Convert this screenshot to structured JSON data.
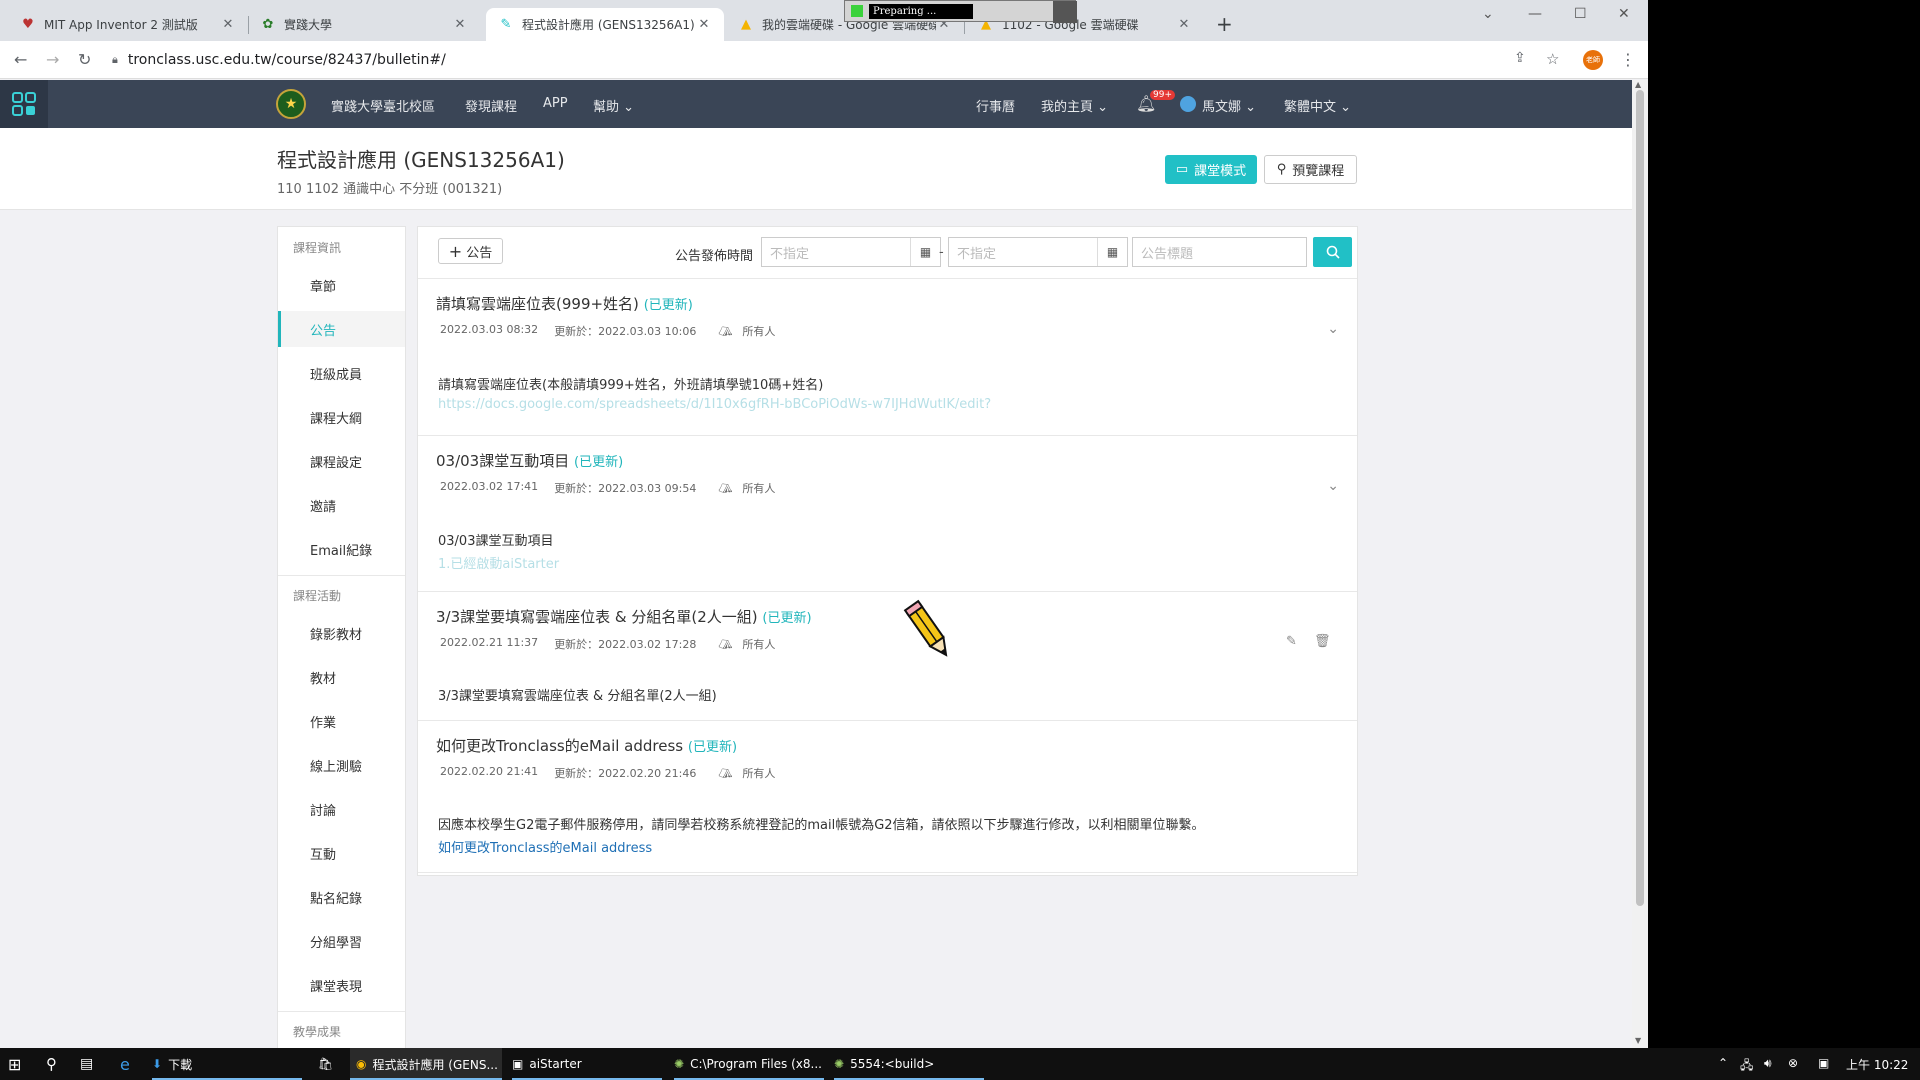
{
  "browser": {
    "tabs": [
      {
        "title": "MIT App Inventor 2 測試版",
        "icon": "app-inventor-icon"
      },
      {
        "title": "實踐大學",
        "icon": "usc-icon"
      },
      {
        "title": "程式設計應用 (GENS13256A1)",
        "icon": "tronclass-icon",
        "active": true
      },
      {
        "title": "我的雲端硬碟 - Google 雲端硬碟",
        "icon": "google-drive-icon"
      },
      {
        "title": "1102 - Google 雲端硬碟",
        "icon": "google-drive-icon"
      }
    ],
    "preparing_label": "Preparing ...",
    "url": "tronclass.usc.edu.tw/course/82437/bulletin#/",
    "profile_label": "老師"
  },
  "topnav": {
    "school": "實踐大學臺北校區",
    "discover": "發現課程",
    "app": "APP",
    "help": "幫助",
    "calendar": "行事曆",
    "home": "我的主頁",
    "notif_count": "99+",
    "user": "馬文娜",
    "language": "繁體中文"
  },
  "course": {
    "title": "程式設計應用 (GENS13256A1)",
    "subtitle": "110 1102 通識中心 不分班 (001321)",
    "classroom_btn": "課堂模式",
    "preview_btn": "預覽課程"
  },
  "sidebar": {
    "section1": "課程資訊",
    "items1": [
      "章節",
      "公告",
      "班級成員",
      "課程大綱",
      "課程設定",
      "邀請",
      "Email紀錄"
    ],
    "section2": "課程活動",
    "items2": [
      "錄影教材",
      "教材",
      "作業",
      "線上測驗",
      "討論",
      "互動",
      "點名紀錄",
      "分組學習",
      "課堂表現"
    ],
    "section3": "教學成果"
  },
  "filter": {
    "add_btn": "公告",
    "publish_label": "公告發佈時間",
    "from_placeholder": "不指定",
    "to_placeholder": "不指定",
    "title_placeholder": "公告標題"
  },
  "posts": [
    {
      "title": "請填寫雲端座位表(999+姓名)",
      "updated": "(已更新)",
      "created": "2022.03.03 08:32",
      "modified": "更新於：2022.03.03 10:06",
      "audience": "所有人",
      "body": "請填寫雲端座位表(本般請填999+姓名，外班請填學號10碼+姓名)",
      "link": "https://docs.google.com/spreadsheets/d/1I10x6gfRH-bBCoPiOdWs-w7IJHdWutIK/edit?"
    },
    {
      "title": "03/03課堂互動項目",
      "updated": "(已更新)",
      "created": "2022.03.02 17:41",
      "modified": "更新於：2022.03.03 09:54",
      "audience": "所有人",
      "body": "03/03課堂互動項目",
      "link": "1.已經啟動aiStarter"
    },
    {
      "title": "3/3課堂要填寫雲端座位表 & 分組名單(2人一組)",
      "updated": "(已更新)",
      "created": "2022.02.21 11:37",
      "modified": "更新於：2022.03.02 17:28",
      "audience": "所有人",
      "body": "3/3課堂要填寫雲端座位表 & 分組名單(2人一組)",
      "link": ""
    },
    {
      "title": "如何更改Tronclass的eMail address",
      "updated": "(已更新)",
      "created": "2022.02.20 21:41",
      "modified": "更新於：2022.02.20 21:46",
      "audience": "所有人",
      "body": "因應本校學生G2電子郵件服務停用，請同學若校務系統裡登記的mail帳號為G2信箱，請依照以下步驟進行修改，以利相關單位聯繫。",
      "link": "如何更改Tronclass的eMail address"
    }
  ],
  "taskbar": {
    "downloads": "下載",
    "chrome": "程式設計應用 (GENS...",
    "aistarter": "aiStarter",
    "cmd": "C:\\Program Files (x8...",
    "emulator": "5554:<build>",
    "clock": "上午 10:22"
  },
  "colors": {
    "accent": "#21c0c6",
    "nav_bg": "#3a4556",
    "badge": "#e53935"
  }
}
